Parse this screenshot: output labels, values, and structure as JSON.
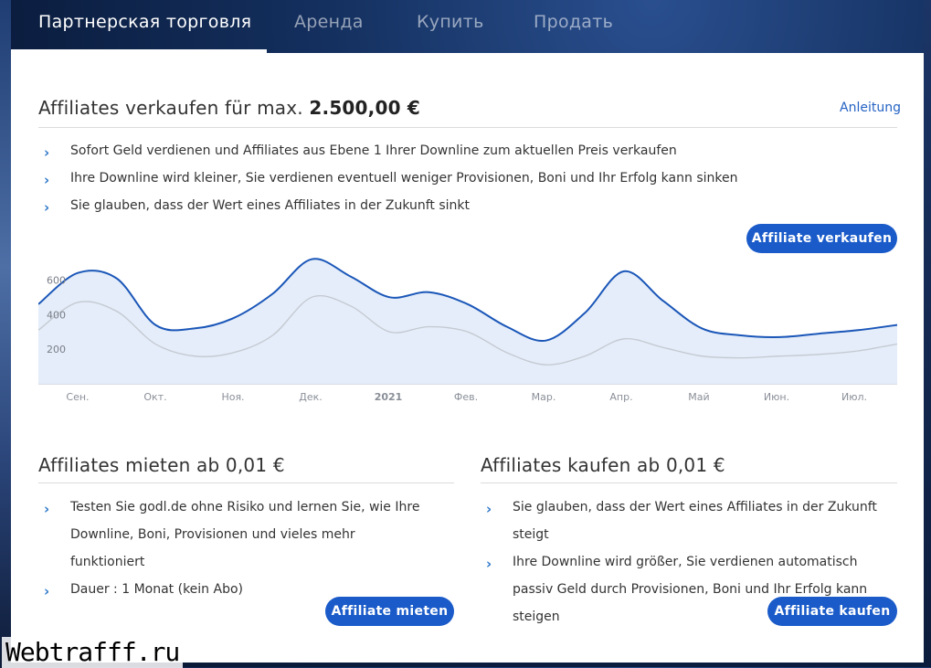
{
  "nav": {
    "tabs": [
      {
        "label": "Партнерская торговля",
        "active": true
      },
      {
        "label": "Аренда",
        "active": false
      },
      {
        "label": "Купить",
        "active": false
      },
      {
        "label": "Продать",
        "active": false
      }
    ]
  },
  "sell": {
    "title_prefix": "Affiliates verkaufen für max.",
    "title_amount": "2.500,00 €",
    "guide_link": "Anleitung",
    "bullets": [
      "Sofort Geld verdienen und Affiliates aus Ebene 1 Ihrer Downline zum aktuellen Preis verkaufen",
      "Ihre Downline wird kleiner, Sie verdienen eventuell weniger Provisionen, Boni und Ihr Erfolg kann sinken",
      "Sie glauben, dass der Wert eines Affiliates in der Zukunft sinkt"
    ],
    "button": "Affiliate verkaufen"
  },
  "chart_data": {
    "type": "area",
    "x": [
      "Сен.",
      "Окт.",
      "Ноя.",
      "Дек.",
      "2021",
      "Фев.",
      "Мар.",
      "Апр.",
      "Май",
      "Июн.",
      "Июл."
    ],
    "yticks": [
      "200",
      "400",
      "600"
    ],
    "ylim": [
      0,
      750
    ],
    "grid": false,
    "legend": "none",
    "colors": {
      "primary": "#1a56b8",
      "secondary": "#c4c8d0",
      "fill": "#e4edf9"
    },
    "series": [
      {
        "values": [
          460,
          640,
          610,
          340,
          320,
          380,
          520,
          720,
          620,
          500,
          530,
          460,
          330,
          250,
          410,
          650,
          480,
          320,
          280,
          270,
          290,
          310,
          340
        ]
      },
      {
        "values": [
          310,
          470,
          420,
          230,
          160,
          180,
          280,
          500,
          450,
          300,
          330,
          300,
          180,
          110,
          160,
          260,
          210,
          160,
          150,
          160,
          170,
          190,
          230
        ]
      }
    ]
  },
  "rent": {
    "title": "Affiliates mieten ab 0,01 €",
    "bullets": [
      "Testen Sie godl.de ohne Risiko und lernen Sie, wie Ihre Downline, Boni, Provisionen und vieles mehr funktioniert",
      "Dauer : 1 Monat (kein Abo)"
    ],
    "button": "Affiliate mieten"
  },
  "buy": {
    "title": "Affiliates kaufen ab 0,01 €",
    "bullets": [
      "Sie glauben, dass der Wert eines Affiliates in der Zukunft steigt",
      "Ihre Downline wird größer, Sie verdienen automatisch passiv Geld durch Provisionen, Boni und Ihr Erfolg kann steigen"
    ],
    "button": "Affiliate kaufen"
  },
  "watermark": "Webtrafff.ru"
}
